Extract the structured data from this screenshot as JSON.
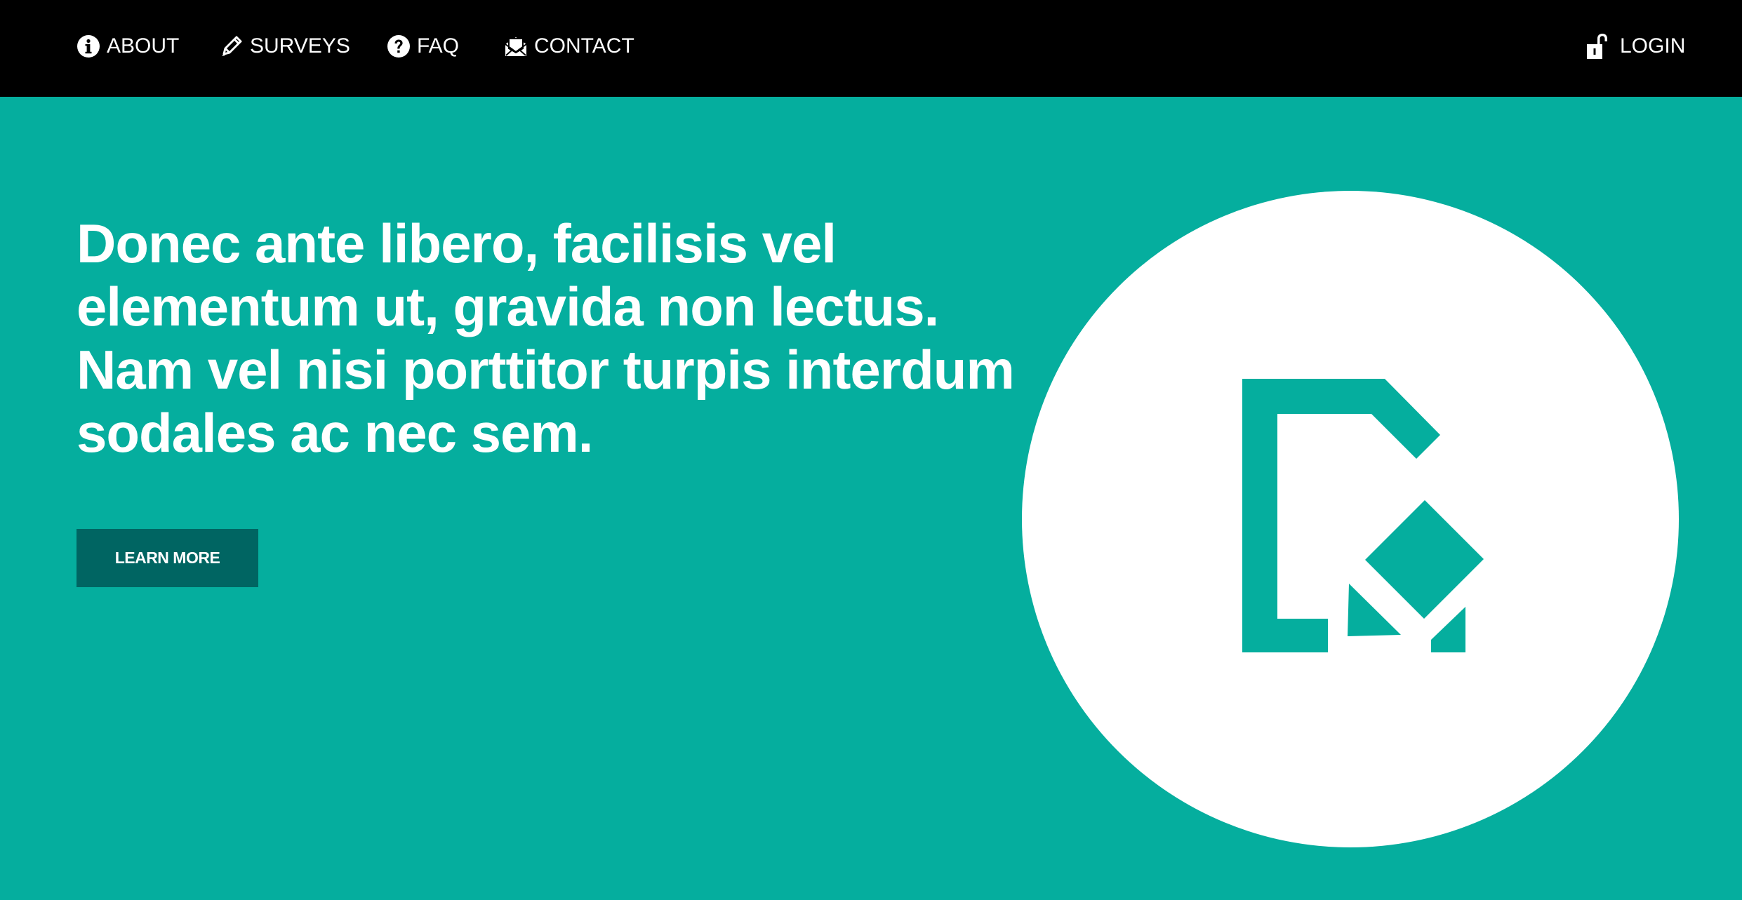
{
  "nav": {
    "items": [
      {
        "label": "ABOUT",
        "icon": "info-circle-icon"
      },
      {
        "label": "SURVEYS",
        "icon": "pencil-icon"
      },
      {
        "label": "FAQ",
        "icon": "question-circle-icon"
      },
      {
        "label": "CONTACT",
        "icon": "envelope-open-icon"
      }
    ],
    "login": {
      "label": "LOGIN",
      "icon": "unlock-icon"
    }
  },
  "hero": {
    "heading": "Donec ante libero, facilisis vel elementum ut, gravida non lectus. Nam vel nisi porttitor turpis interdum sodales ac nec sem.",
    "button_label": "LEARN MORE",
    "illustration_icon": "survey-document-edit-icon"
  },
  "colors": {
    "navbar_bg": "#000000",
    "hero_bg": "#05ae9e",
    "button_bg": "#006562",
    "text": "#ffffff",
    "circle": "#ffffff"
  }
}
